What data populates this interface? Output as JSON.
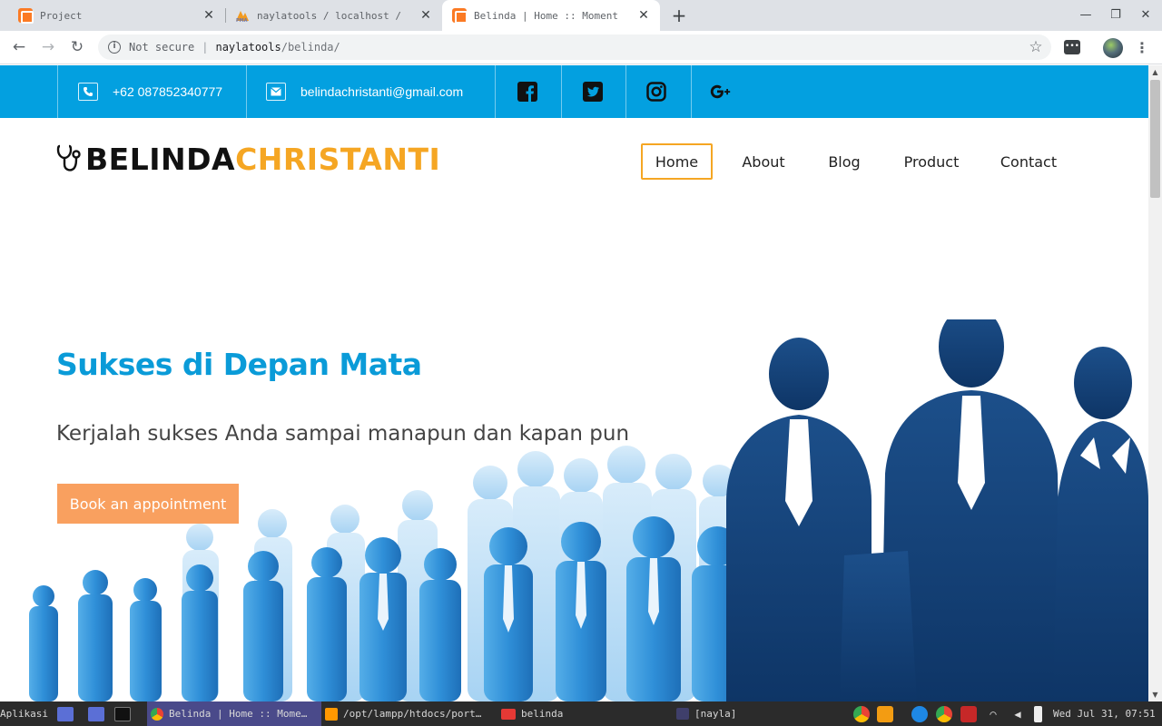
{
  "browser": {
    "tabs": [
      {
        "title": "Project",
        "icon": "xampp-icon"
      },
      {
        "title": "naylatools / localhost / ",
        "icon": "phpmyadmin-icon"
      },
      {
        "title": "Belinda | Home :: Moment",
        "icon": "xampp-icon",
        "active": true
      }
    ],
    "address": {
      "security": "Not secure",
      "host": "naylatools",
      "path": "/belinda/"
    }
  },
  "site": {
    "topbar": {
      "phone": "+62 087852340777",
      "email": "belindachristanti@gmail.com",
      "socials": [
        "facebook-icon",
        "twitter-icon",
        "instagram-icon",
        "google-plus-icon"
      ]
    },
    "logo": {
      "part1": "BELINDA",
      "part2": "CHRISTANTI"
    },
    "nav": [
      "Home",
      "About",
      "Blog",
      "Product",
      "Contact"
    ],
    "nav_active": "Home",
    "hero": {
      "title": "Sukses di Depan Mata",
      "subtitle": "Kerjalah sukses Anda sampai manapun dan kapan pun",
      "button": "Book an appointment"
    },
    "colors": {
      "primary": "#03a0e0",
      "accent": "#f5a623",
      "cta": "#f9a05f"
    }
  },
  "taskbar": {
    "menu": "Aplikasi",
    "items": [
      {
        "label": "Belinda | Home :: Mome…",
        "active": true
      },
      {
        "label": "/opt/lampp/htdocs/port…"
      },
      {
        "label": "belinda"
      },
      {
        "label": "[nayla]"
      }
    ],
    "clock": "Wed Jul 31, 07:51"
  }
}
